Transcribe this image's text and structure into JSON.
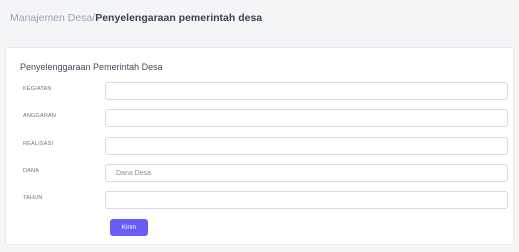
{
  "breadcrumb": {
    "parent": "Manajemen Desa/",
    "current": "Penyelengaraan pemerintah desa"
  },
  "form": {
    "title": "Penyelenggaraan Pemerintah Desa",
    "fields": [
      {
        "label": "KEGIATAN",
        "value": "",
        "placeholder": ""
      },
      {
        "label": "ANGGARAN",
        "value": "",
        "placeholder": ""
      },
      {
        "label": "REALISASI",
        "value": "",
        "placeholder": ""
      },
      {
        "label": "DANA",
        "value": "",
        "placeholder": "Dana Desa"
      },
      {
        "label": "TAHUN",
        "value": "",
        "placeholder": ""
      }
    ],
    "submit_label": "Kirim"
  },
  "colors": {
    "accent": "#6a5cf6",
    "page_background": "#f4f5f7",
    "breadcrumb_muted": "#9aa3b5"
  }
}
